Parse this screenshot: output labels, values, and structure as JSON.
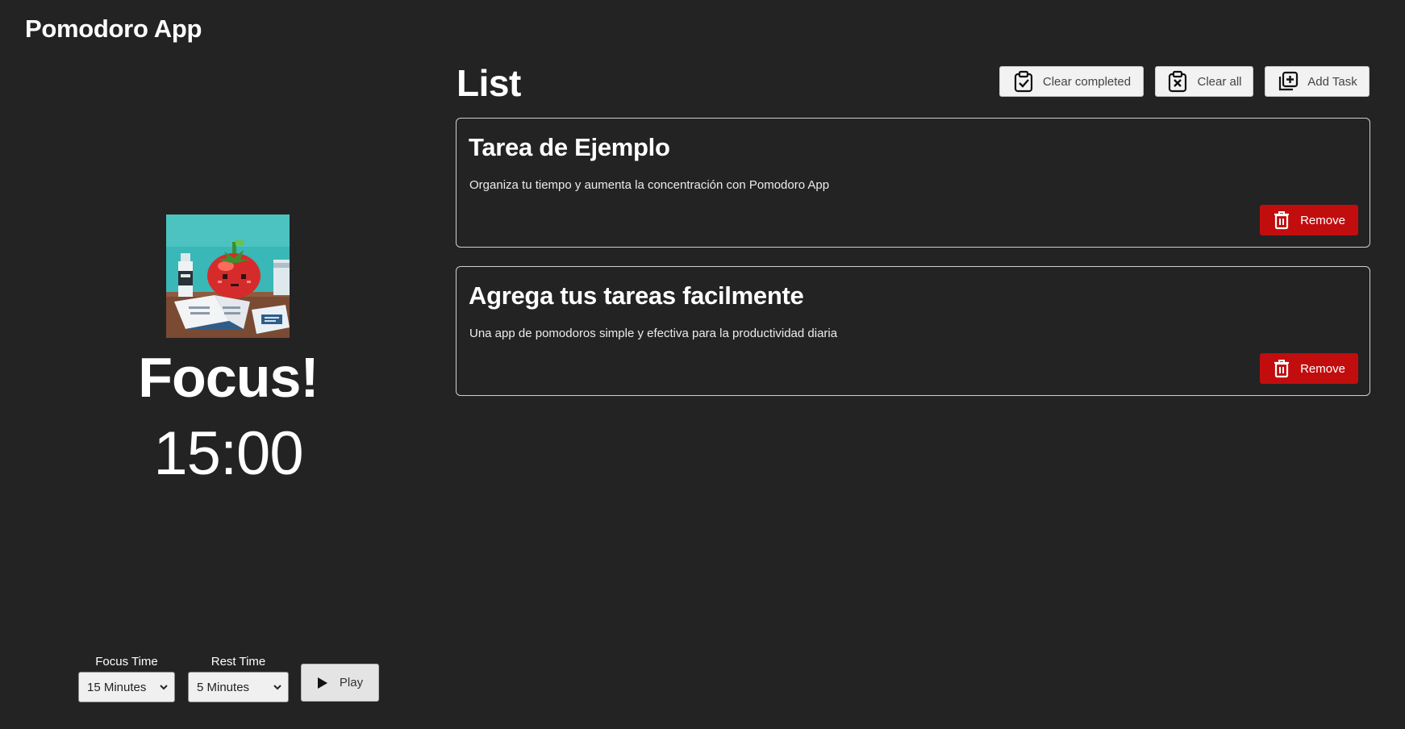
{
  "app": {
    "title": "Pomodoro App"
  },
  "timer": {
    "mode_label": "Focus!",
    "display": "15:00",
    "image_icon": "pixel-tomato-studying-illustration"
  },
  "controls": {
    "focus_time_label": "Focus Time",
    "focus_time_value": "15 Minutes",
    "rest_time_label": "Rest Time",
    "rest_time_value": "5 Minutes",
    "play_label": "Play"
  },
  "list": {
    "title": "List",
    "toolbar": {
      "clear_completed_label": "Clear completed",
      "clear_all_label": "Clear all",
      "add_task_label": "Add Task"
    },
    "tasks": [
      {
        "title": "Tarea de Ejemplo",
        "description": "Organiza tu tiempo y aumenta la concentración con Pomodoro App",
        "remove_label": "Remove"
      },
      {
        "title": "Agrega tus tareas facilmente",
        "description": "Una app de pomodoros simple y efectiva para la productividad diaria",
        "remove_label": "Remove"
      }
    ]
  },
  "colors": {
    "background": "#232323",
    "remove_button": "#c10d0d",
    "button_light": "#f2f2f2"
  }
}
